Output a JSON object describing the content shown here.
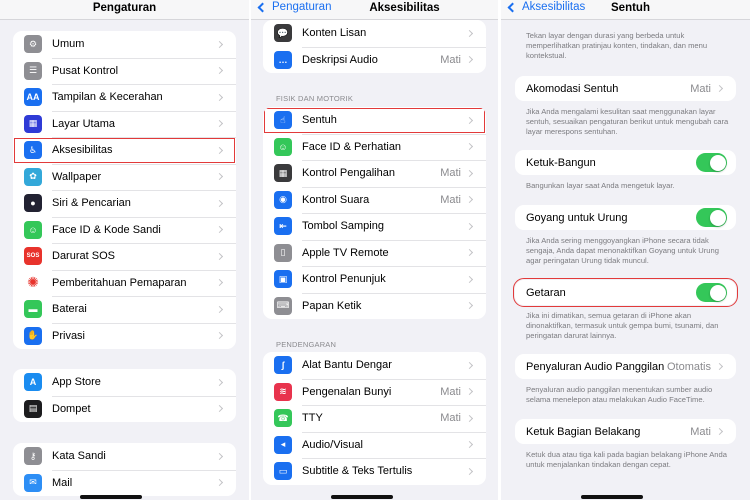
{
  "colors": {
    "accent": "#1a6ff0",
    "toggle_on": "#34c759",
    "highlight": "#e23a3a",
    "background": "#f1f1f6"
  },
  "panel1": {
    "title": "Pengaturan",
    "groups": [
      [
        {
          "label": "Umum",
          "icon": "gear-icon",
          "color": "#8e8e93"
        },
        {
          "label": "Pusat Kontrol",
          "icon": "switches-icon",
          "color": "#8e8e93"
        },
        {
          "label": "Tampilan & Kecerahan",
          "icon": "text-size-icon",
          "color": "#1a6ff0"
        },
        {
          "label": "Layar Utama",
          "icon": "home-grid-icon",
          "color": "#2f3bd6"
        },
        {
          "label": "Aksesibilitas",
          "icon": "accessibility-icon",
          "color": "#1a6ff0",
          "highlight": true
        },
        {
          "label": "Wallpaper",
          "icon": "flower-icon",
          "color": "#33a8d9"
        },
        {
          "label": "Siri & Pencarian",
          "icon": "siri-icon",
          "color": "#222232"
        },
        {
          "label": "Face ID & Kode Sandi",
          "icon": "face-id-icon",
          "color": "#34c759"
        },
        {
          "label": "Darurat SOS",
          "icon": "sos-icon",
          "color": "#e8332c"
        },
        {
          "label": "Pemberitahuan Pemaparan",
          "icon": "exposure-icon",
          "color": "#ffffff"
        },
        {
          "label": "Baterai",
          "icon": "battery-icon",
          "color": "#34c759"
        },
        {
          "label": "Privasi",
          "icon": "hand-icon",
          "color": "#1a6ff0"
        }
      ],
      [
        {
          "label": "App Store",
          "icon": "app-store-icon",
          "color": "#1a8cf0"
        },
        {
          "label": "Dompet",
          "icon": "wallet-icon",
          "color": "#1c1c1e"
        }
      ],
      [
        {
          "label": "Kata Sandi",
          "icon": "key-icon",
          "color": "#8e8e93"
        },
        {
          "label": "Mail",
          "icon": "mail-icon",
          "color": "#2d8ef5"
        }
      ]
    ]
  },
  "panel2": {
    "back_label": "Pengaturan",
    "title": "Aksesibilitas",
    "top_group": [
      {
        "label": "Konten Lisan",
        "icon": "speech-bubble-icon",
        "color": "#3a3a3c"
      },
      {
        "label": "Deskripsi Audio",
        "icon": "audio-description-icon",
        "color": "#1a6ff0",
        "value": "Mati"
      }
    ],
    "section_physical": "FISIK DAN MOTORIK",
    "physical_group": [
      {
        "label": "Sentuh",
        "icon": "touch-hand-icon",
        "color": "#1a6ff0",
        "highlight": true
      },
      {
        "label": "Face ID & Perhatian",
        "icon": "face-id-icon",
        "color": "#34c759"
      },
      {
        "label": "Kontrol Pengalihan",
        "icon": "switch-control-icon",
        "color": "#3a3a3c",
        "value": "Mati"
      },
      {
        "label": "Kontrol Suara",
        "icon": "voice-control-icon",
        "color": "#1a6ff0",
        "value": "Mati"
      },
      {
        "label": "Tombol Samping",
        "icon": "side-button-icon",
        "color": "#1a6ff0"
      },
      {
        "label": "Apple TV Remote",
        "icon": "remote-icon",
        "color": "#8e8e93"
      },
      {
        "label": "Kontrol Penunjuk",
        "icon": "pointer-control-icon",
        "color": "#1a6ff0"
      },
      {
        "label": "Papan Ketik",
        "icon": "keyboard-icon",
        "color": "#8e8e93"
      }
    ],
    "section_hearing": "PENDENGARAN",
    "hearing_group": [
      {
        "label": "Alat Bantu Dengar",
        "icon": "ear-icon",
        "color": "#1a6ff0"
      },
      {
        "label": "Pengenalan Bunyi",
        "icon": "sound-recognition-icon",
        "color": "#e8334d",
        "value": "Mati"
      },
      {
        "label": "TTY",
        "icon": "tty-icon",
        "color": "#34c759",
        "value": "Mati"
      },
      {
        "label": "Audio/Visual",
        "icon": "audio-visual-icon",
        "color": "#1a6ff0"
      },
      {
        "label": "Subtitle & Teks Tertulis",
        "icon": "subtitle-icon",
        "color": "#1a6ff0"
      }
    ]
  },
  "panel3": {
    "back_label": "Aksesibilitas",
    "title": "Sentuh",
    "top_footer": "Tekan layar dengan durasi yang berbeda untuk memperlihatkan pratinjau konten, tindakan, dan menu kontekstual.",
    "items": [
      {
        "label": "Akomodasi Sentuh",
        "value": "Mati",
        "type": "link",
        "footer": "Jika Anda mengalami kesulitan saat menggunakan layar sentuh, sesuaikan pengaturan berikut untuk mengubah cara layar merespons sentuhan."
      },
      {
        "label": "Ketuk-Bangun",
        "type": "toggle",
        "on": true,
        "footer": "Bangunkan layar saat Anda mengetuk layar."
      },
      {
        "label": "Goyang untuk Urung",
        "type": "toggle",
        "on": true,
        "footer": "Jika Anda sering menggoyangkan iPhone secara tidak sengaja, Anda dapat menonaktifkan Goyang untuk Urung agar peringatan Urung tidak muncul."
      },
      {
        "label": "Getaran",
        "type": "toggle",
        "on": true,
        "highlight": true,
        "footer": "Jika ini dimatikan, semua getaran di iPhone akan dinonaktifkan, termasuk untuk gempa bumi, tsunami, dan peringatan darurat lainnya."
      },
      {
        "label": "Penyaluran Audio Panggilan",
        "value": "Otomatis",
        "type": "link",
        "footer": "Penyaluran audio panggilan menentukan sumber audio selama menelepon atau melakukan Audio FaceTime."
      },
      {
        "label": "Ketuk Bagian Belakang",
        "value": "Mati",
        "type": "link",
        "footer": "Ketuk dua atau tiga kali pada bagian belakang iPhone Anda untuk menjalankan tindakan dengan cepat."
      }
    ]
  }
}
